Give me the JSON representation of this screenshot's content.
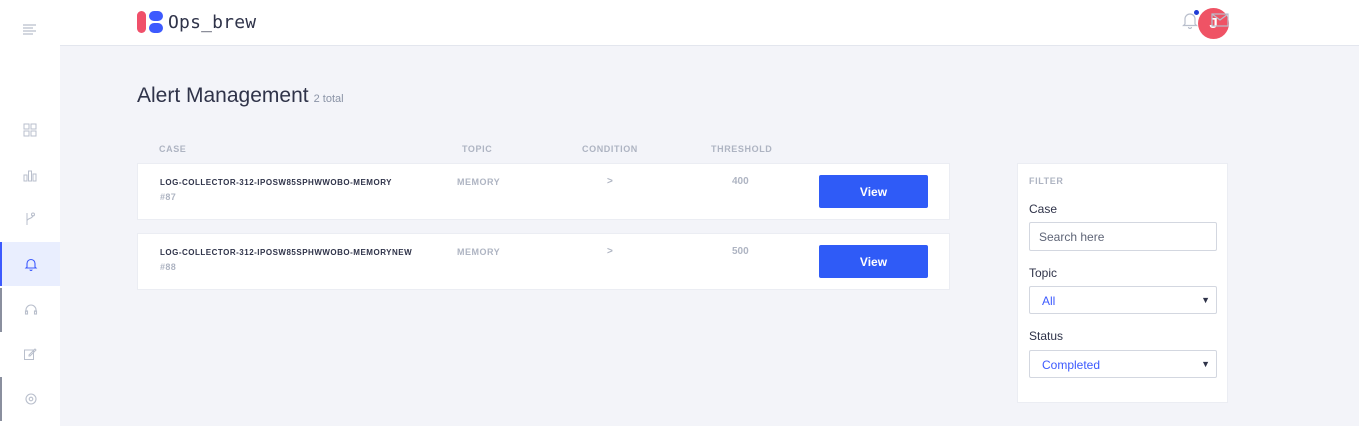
{
  "header": {
    "brand": "Ops_brew",
    "avatar_initial": "J"
  },
  "page": {
    "title": "Alert Management",
    "count": "2 total"
  },
  "table": {
    "columns": [
      "CASE",
      "TOPIC",
      "CONDITION",
      "THRESHOLD"
    ],
    "rows": [
      {
        "case": "LOG-COLLECTOR-312-IPOSW85SPHWWOBO-MEMORY",
        "id": "#87",
        "topic": "MEMORY",
        "condition": ">",
        "threshold": "400",
        "action": "View"
      },
      {
        "case": "LOG-COLLECTOR-312-IPOSW85SPHWWOBO-MEMORYNEW",
        "id": "#88",
        "topic": "MEMORY",
        "condition": ">",
        "threshold": "500",
        "action": "View"
      }
    ]
  },
  "filter": {
    "title": "FILTER",
    "case_label": "Case",
    "case_placeholder": "Search here",
    "topic_label": "Topic",
    "topic_value": "All",
    "status_label": "Status",
    "status_value": "Completed"
  },
  "sidebar": {
    "items": [
      "dashboard-icon",
      "chart-icon",
      "branch-icon",
      "bell-icon",
      "headset-icon",
      "edit-icon",
      "settings-icon"
    ],
    "active": "bell-icon"
  },
  "colors": {
    "accent": "#2f5bf7",
    "avatar": "#ef5365",
    "background": "#f3f4f9"
  }
}
